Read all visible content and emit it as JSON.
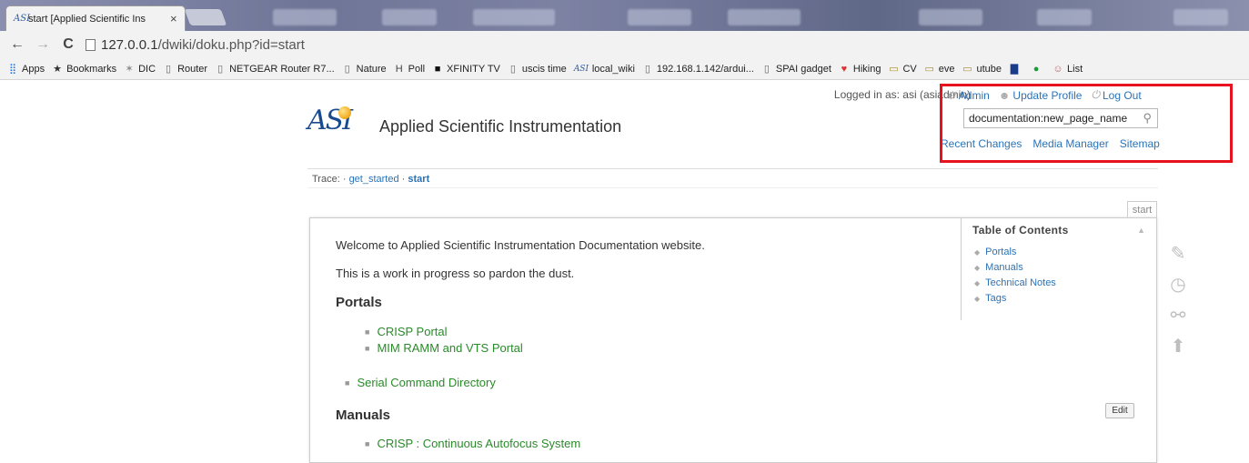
{
  "browser": {
    "tab_title": "start [Applied Scientific Ins",
    "tab_favicon": "ASI",
    "tab_close": "×",
    "url_host": "127.0.0.1",
    "url_path": "/dwiki/doku.php?id=start",
    "bookmarks": [
      {
        "icon": "apps-grid-icon",
        "glyph": "⣿",
        "label": "Apps",
        "color": "#1a73e8"
      },
      {
        "icon": "star-icon",
        "glyph": "★",
        "label": "Bookmarks",
        "color": "#333"
      },
      {
        "icon": "dic-icon",
        "glyph": "✶",
        "label": "DIC",
        "color": "#888"
      },
      {
        "icon": "page-icon",
        "glyph": "▯",
        "label": "Router",
        "color": "#666"
      },
      {
        "icon": "page-icon",
        "glyph": "▯",
        "label": "NETGEAR Router R7...",
        "color": "#666"
      },
      {
        "icon": "page-icon",
        "glyph": "▯",
        "label": "Nature",
        "color": "#666"
      },
      {
        "icon": "poll-icon",
        "glyph": "H",
        "label": "Poll",
        "color": "#444"
      },
      {
        "icon": "tv-icon",
        "glyph": "■",
        "label": "XFINITY TV",
        "color": "#111"
      },
      {
        "icon": "page-icon",
        "glyph": "▯",
        "label": "uscis time",
        "color": "#666"
      },
      {
        "icon": "wiki-icon",
        "glyph": "ASI",
        "label": "local_wiki",
        "color": "#2e5c9e"
      },
      {
        "icon": "page-icon",
        "glyph": "▯",
        "label": "192.168.1.142/ardui...",
        "color": "#666"
      },
      {
        "icon": "page-icon",
        "glyph": "▯",
        "label": "SPAI gadget",
        "color": "#666"
      },
      {
        "icon": "hiking-icon",
        "glyph": "♥",
        "label": "Hiking",
        "color": "#d33"
      },
      {
        "icon": "folder-icon",
        "glyph": "▭",
        "label": "CV",
        "color": "#a88a2a"
      },
      {
        "icon": "folder-icon",
        "glyph": "▭",
        "label": "eve",
        "color": "#a88a2a"
      },
      {
        "icon": "folder-icon",
        "glyph": "▭",
        "label": "utube",
        "color": "#a88a2a"
      },
      {
        "icon": "chart-icon",
        "glyph": "▇",
        "label": "",
        "color": "#1a3a8a"
      },
      {
        "icon": "green-circle-icon",
        "glyph": "●",
        "label": "",
        "color": "#1a9a3a"
      },
      {
        "icon": "list-icon",
        "glyph": "☺",
        "label": "List",
        "color": "#b66"
      }
    ]
  },
  "header": {
    "logged_in": "Logged in as: asi (asiadmin)",
    "admin": "Admin",
    "update_profile": "Update Profile",
    "logout": "Log Out",
    "search_value": "documentation:new_page_name",
    "recent_changes": "Recent Changes",
    "media_manager": "Media Manager",
    "sitemap": "Sitemap",
    "logo_text": "ASI",
    "site_title": "Applied Scientific Instrumentation"
  },
  "breadcrumb": {
    "label": "Trace:",
    "sep": "·",
    "items": [
      "get_started",
      "start"
    ]
  },
  "page_tab": "start",
  "toc": {
    "title": "Table of Contents",
    "items": [
      "Portals",
      "Manuals",
      "Technical Notes",
      "Tags"
    ]
  },
  "content": {
    "intro1": "Welcome to Applied Scientific Instrumentation Documentation website.",
    "intro2": "This is a work in progress so pardon the dust.",
    "portals_heading": "Portals",
    "portals_items": [
      "CRISP Portal",
      "MIM RAMM and VTS Portal"
    ],
    "serial_item": "Serial Command Directory",
    "manuals_heading": "Manuals",
    "manuals_first": "CRISP : Continuous Autofocus System",
    "edit_label": "Edit"
  }
}
